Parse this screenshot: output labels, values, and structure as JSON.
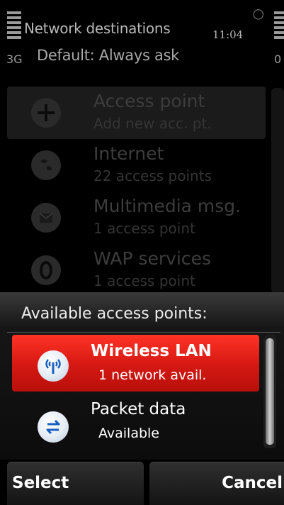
{
  "status_bar": {
    "title": "Network destinations",
    "time": "11:04",
    "network_type": "3G",
    "subtitle": "Default: Always ask",
    "right_indicator": "0"
  },
  "background_list": {
    "items": [
      {
        "title": "Access point",
        "subtitle": "Add new acc. pt.",
        "icon": "access-point-icon"
      },
      {
        "title": "Internet",
        "subtitle": "22 access points",
        "icon": "globe-icon"
      },
      {
        "title": "Multimedia msg.",
        "subtitle": "1 access point",
        "icon": "mms-icon"
      },
      {
        "title": "WAP services",
        "subtitle": "1 access point",
        "icon": "wap-icon"
      }
    ]
  },
  "popup": {
    "heading": "Available access points:",
    "items": [
      {
        "title": "Wireless LAN",
        "subtitle": "1 network avail.",
        "icon": "wireless-lan-icon",
        "selected": true
      },
      {
        "title": "Packet data",
        "subtitle": "Available",
        "icon": "packet-data-icon",
        "selected": false
      }
    ]
  },
  "softkeys": {
    "left": "Select",
    "right": "Cancel"
  },
  "colors": {
    "highlight": "#e8231a",
    "icon_blue": "#1a5fc4"
  }
}
